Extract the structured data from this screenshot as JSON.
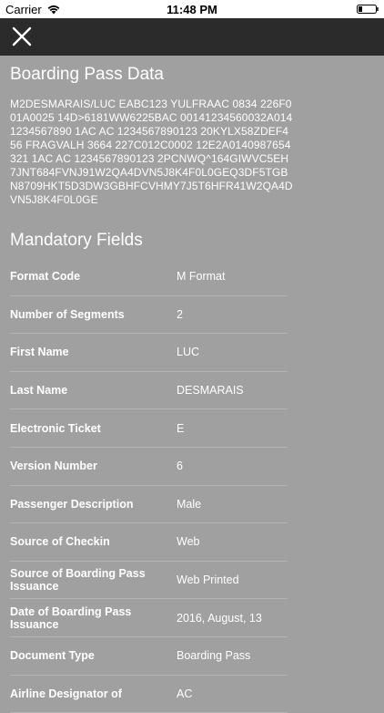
{
  "status_bar": {
    "carrier": "Carrier",
    "time": "11:48 PM"
  },
  "nav": {
    "close_icon": "close-icon"
  },
  "boarding_pass": {
    "title": "Boarding Pass Data",
    "raw": "M2DESMARAIS/LUC       EABC123 YULFRAAC 0834 226F001A0025 14D>6181WW6225BAC 00141234560032A0141234567890 1AC AC 1234567890123    20KYLX58ZDEF456 FRAGVALH 3664 227C012C0002 12E2A0140987654321 1AC AC 1234567890123    2PCNWQ^164GIWVC5EH7JNT684FVNJ91W2QA4DVN5J8K4F0L0GEQ3DF5TGBN8709HKT5D3DW3GBHFCVHMY7J5T6HFR41W2QA4DVN5J8K4F0L0GE"
  },
  "mandatory": {
    "title": "Mandatory Fields",
    "rows": [
      {
        "label": "Format Code",
        "value": "M Format"
      },
      {
        "label": "Number of Segments",
        "value": "2"
      },
      {
        "label": "First Name",
        "value": "LUC"
      },
      {
        "label": "Last Name",
        "value": "DESMARAIS"
      },
      {
        "label": "Electronic Ticket",
        "value": "E"
      },
      {
        "label": "Version Number",
        "value": "6"
      },
      {
        "label": "Passenger Description",
        "value": "Male"
      },
      {
        "label": "Source of Checkin",
        "value": "Web"
      },
      {
        "label": "Source of Boarding Pass Issuance",
        "value": "Web Printed"
      },
      {
        "label": "Date of Boarding Pass Issuance",
        "value": "2016, August, 13"
      },
      {
        "label": "Document Type",
        "value": "Boarding Pass"
      },
      {
        "label": "Airline Designator of",
        "value": "AC"
      }
    ]
  }
}
